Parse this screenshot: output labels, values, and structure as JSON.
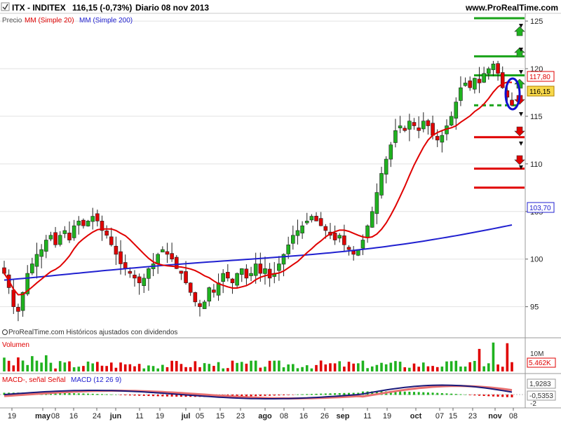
{
  "header": {
    "symbol": "ITX - INDITEX",
    "price_text": "116,15 (-0,73%)",
    "period": "Diario",
    "date": "08 nov 2013",
    "site": "www.ProRealTime.com"
  },
  "price_panel": {
    "legend_price": "Precio",
    "legend_mm20": "MM (Simple 20)",
    "legend_mm200": "MM (Simple 200)",
    "footer_note": "ProRealTime.com Históricos ajustados con dividendos",
    "last_price_label": "116,15",
    "mm20_label": "117,80",
    "mm200_label": "103,70"
  },
  "volume_panel": {
    "title": "Volumen",
    "axis_label": "10M",
    "last_label": "5.462K"
  },
  "macd_panel": {
    "legend_macd_minus": "MACD-, señal Señal",
    "legend_macd": "MACD (12 26 9)",
    "macd_label": "1,9283",
    "signal_label": "-0,5353",
    "axis_label": "-2"
  },
  "colors": {
    "up": "#1fb21f",
    "down": "#e00000",
    "mm20": "#e00000",
    "mm200": "#2020d0",
    "level_green": "#19a319",
    "level_red": "#e00000",
    "ellipse": "#1010d0",
    "badge_last": "#f7d84a",
    "badge_mm20": "#ffffff",
    "badge_mm200": "#ffffff"
  },
  "chart_data": [
    {
      "type": "candlestick",
      "title": "ITX - INDITEX",
      "ylim": [
        92,
        126
      ],
      "y_ticks": [
        "95",
        "100",
        "105",
        "110",
        "115",
        "120",
        "125"
      ],
      "x_ticks": [
        "19",
        "may",
        "08",
        "16",
        "24",
        "jun",
        "11",
        "19",
        "jul",
        "05",
        "15",
        "23",
        "ago",
        "08",
        "16",
        "26",
        "sep",
        "11",
        "19",
        "oct",
        "07",
        "15",
        "23",
        "nov",
        "08"
      ],
      "close_series": [
        98.5,
        97.0,
        95.0,
        94.5,
        96.5,
        98.5,
        99.5,
        100.5,
        101.0,
        102.0,
        102.5,
        101.5,
        102.5,
        103.0,
        102.0,
        103.5,
        104.0,
        103.5,
        104.0,
        104.5,
        104.0,
        103.0,
        102.5,
        101.5,
        100.5,
        99.5,
        99.0,
        98.5,
        98.0,
        97.5,
        98.0,
        99.0,
        99.5,
        100.5,
        101.0,
        100.5,
        100.0,
        99.0,
        98.5,
        97.5,
        96.5,
        95.5,
        95.0,
        95.5,
        97.0,
        96.5,
        97.5,
        98.5,
        98.0,
        97.5,
        98.5,
        99.0,
        98.0,
        98.5,
        99.5,
        98.5,
        99.0,
        98.0,
        98.5,
        99.5,
        100.5,
        101.5,
        102.5,
        103.0,
        103.5,
        104.0,
        104.5,
        104.0,
        103.5,
        103.0,
        102.5,
        102.0,
        102.5,
        101.5,
        101.0,
        100.5,
        101.0,
        102.0,
        103.5,
        105.0,
        107.0,
        109.0,
        110.5,
        112.0,
        113.5,
        114.0,
        113.5,
        114.5,
        114.0,
        113.5,
        114.5,
        114.0,
        113.0,
        112.5,
        113.0,
        114.0,
        115.0,
        116.5,
        118.0,
        118.5,
        118.0,
        119.0,
        118.5,
        119.5,
        120.0,
        120.5,
        119.5,
        118.0,
        117.0,
        116.15
      ],
      "series": [
        {
          "name": "MM (Simple 20)",
          "last": 117.8
        },
        {
          "name": "MM (Simple 200)",
          "last": 103.7
        }
      ],
      "price_levels": [
        {
          "value": 125.3,
          "color": "green"
        },
        {
          "value": 121.3,
          "color": "green"
        },
        {
          "value": 119.3,
          "color": "green"
        },
        {
          "value": 116.15,
          "color": "green",
          "style": "dashed"
        },
        {
          "value": 112.8,
          "color": "red"
        },
        {
          "value": 109.5,
          "color": "red"
        },
        {
          "value": 107.5,
          "color": "red"
        }
      ],
      "last_price": 116.15
    },
    {
      "type": "bar",
      "title": "Volumen",
      "ylim": [
        0,
        12000000
      ],
      "last_value_label": "5.462K"
    },
    {
      "type": "line",
      "title": "MACD (12 26 9)",
      "series": [
        {
          "name": "MACD",
          "last": 1.9283
        },
        {
          "name": "Señal",
          "last": -0.5353
        }
      ]
    }
  ]
}
